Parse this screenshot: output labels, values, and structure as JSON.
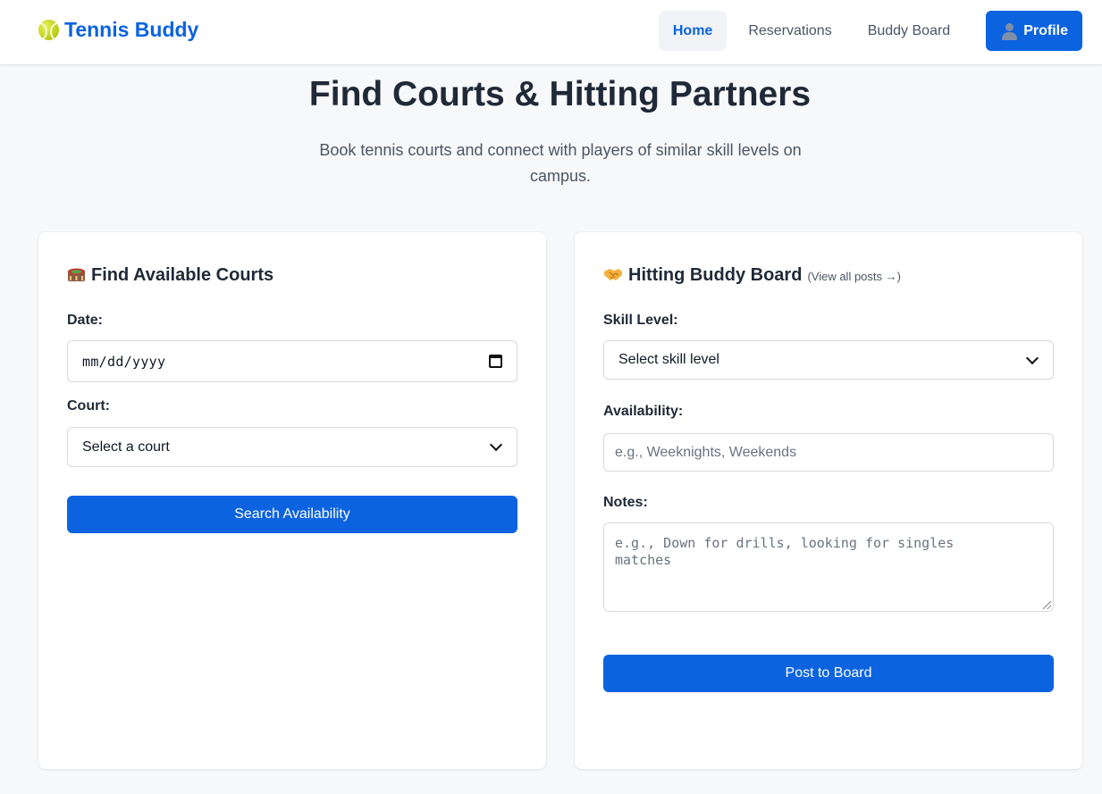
{
  "header": {
    "brand": "Tennis Buddy",
    "nav": {
      "home": "Home",
      "reservations": "Reservations",
      "buddy_board": "Buddy Board",
      "profile": "Profile"
    }
  },
  "hero": {
    "title": "Find Courts & Hitting Partners",
    "subtitle": "Book tennis courts and connect with players of similar skill levels on campus."
  },
  "courts_card": {
    "title": "Find Available Courts",
    "date_label": "Date:",
    "date_placeholder": "mm/dd/yyyy",
    "court_label": "Court:",
    "court_selected": "Select a court",
    "search_button": "Search Availability"
  },
  "buddy_card": {
    "title": "Hitting Buddy Board",
    "view_all": "(View all posts →)",
    "skill_label": "Skill Level:",
    "skill_selected": "Select skill level",
    "availability_label": "Availability:",
    "availability_placeholder": "e.g., Weeknights, Weekends",
    "notes_label": "Notes:",
    "notes_placeholder": "e.g., Down for drills, looking for singles matches",
    "post_button": "Post to Board"
  },
  "colors": {
    "accent": "#0b63e0",
    "background": "#f7f8fa",
    "text": "#1f2937"
  },
  "icons": {
    "brand": "tennis-ball-icon",
    "profile": "user-icon",
    "courts": "stadium-icon",
    "buddy": "handshake-icon",
    "date": "calendar-icon",
    "select": "chevron-down-icon"
  }
}
